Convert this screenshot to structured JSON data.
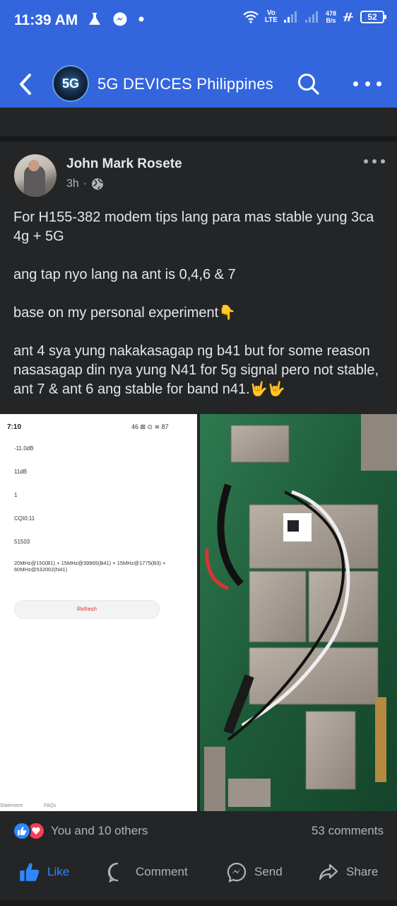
{
  "status_bar": {
    "time": "11:39 AM",
    "network_top": "Vo",
    "network_bottom": "LTE",
    "speed_top": "478",
    "speed_bottom": "B/s",
    "battery": "52"
  },
  "group": {
    "avatar_text": "5G",
    "name": "5G DEVICES Philippines"
  },
  "actions": {
    "like": "Like",
    "comment": "Comment",
    "send": "Send",
    "share": "Share"
  },
  "post": {
    "author": "John Mark Rosete",
    "time": "3h",
    "paragraphs": [
      "For H155-382 modem tips lang para mas stable yung 3ca 4g + 5G",
      "ang tap nyo lang na ant is 0,4,6 & 7",
      "base on my personal experiment👇",
      "ant 4 sya yung nakakasagap ng b41 but for some reason nasasagap din nya yung N41 for 5g signal pero not stable, ant 7 & ant 6 ang stable for band n41.🤟🤟"
    ]
  },
  "screenshot_image": {
    "time": "7:10",
    "status_icons": "46 ⊠ ⊙ ≋ 87",
    "values": [
      "-11.0dB",
      "11dB",
      "1",
      "CQI0:11",
      "51503"
    ],
    "bands": "20MHz@150(B1) + 15MHz@39965(B41) + 15MHz@1775(B3) + 60MHz@532002(N41)",
    "refresh": "Refresh",
    "footer_left": "Statement",
    "footer_right": "FAQs"
  },
  "reactions": {
    "summary": "You and 10 others",
    "comments": "53 comments"
  },
  "colors": {
    "header_blue": "#3366dd",
    "background": "#242526",
    "like_blue": "#2d88ff",
    "love_red": "#f33e58"
  }
}
